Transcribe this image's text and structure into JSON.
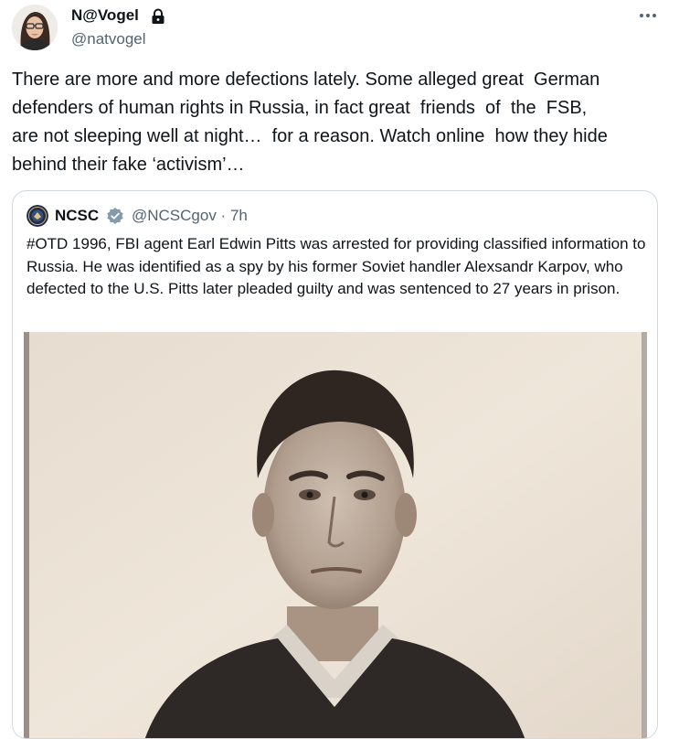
{
  "author": {
    "display_name": "N@Vogel",
    "handle": "@natvogel",
    "protected_icon": "lock-icon"
  },
  "menu_icon": "more-horizontal-icon",
  "tweet": {
    "text": "There are more and more defections lately. Some alleged great  German\ndefenders of human rights in Russia, in fact great  friends  of  the  FSB,\nare not sleeping well at night…  for a reason. Watch online  how they hide\nbehind their fake ‘activism’…"
  },
  "quoted_tweet": {
    "display_name": "NCSC",
    "verified_icon": "verified-badge-icon",
    "handle_time": "@NCSCgov · 7h",
    "text": "#OTD 1996, FBI agent Earl Edwin Pitts was arrested for providing classified information to Russia. He was identified as a spy by his former Soviet handler Alexsandr Karpov, who defected to the U.S. Pitts later pleaded guilty and was sentenced to 27 years in prison.",
    "media": "sepia-portrait-photo"
  },
  "colors": {
    "text_primary": "#0f1419",
    "text_secondary": "#536471",
    "border": "#cfd9de",
    "verified": "#829aab"
  }
}
